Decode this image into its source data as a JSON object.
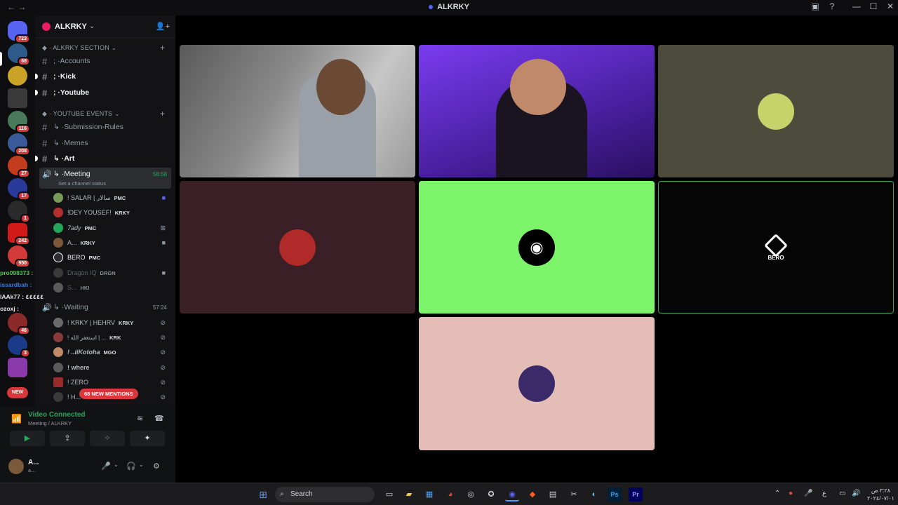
{
  "window": {
    "title": "ALKRKY",
    "nav_back": "←",
    "nav_forward": "→",
    "controls": [
      "▣",
      "?",
      "—",
      "☐",
      "✕"
    ]
  },
  "guilds": [
    {
      "badge": "723",
      "color": "#5865f2"
    },
    {
      "badge": "68",
      "color": "#2d5a8a"
    },
    {
      "badge": "",
      "color": "#c9a227"
    },
    {
      "badge": "",
      "color": "#3a3a3a"
    },
    {
      "badge": "116",
      "color": "#4a7a5a"
    },
    {
      "badge": "208",
      "color": "#3a5a9a"
    },
    {
      "badge": "27",
      "color": "#c43c1e"
    },
    {
      "badge": "17",
      "color": "#2a3a9a"
    },
    {
      "badge": "1",
      "color": "#2a2a2a"
    },
    {
      "badge": "242",
      "color": "#d21a1a"
    },
    {
      "badge": "950",
      "color": "#d23a3a"
    },
    {
      "badge": "46",
      "color": "#8a2a2a"
    },
    {
      "badge": "3",
      "color": "#1a3a8a"
    },
    {
      "badge": "",
      "color": "#8a3aaa"
    },
    {
      "badge": "NEW",
      "color": "#da373c"
    }
  ],
  "server": {
    "name": "ALKRKY",
    "chevron": "⌄",
    "invite_icon": "👤+"
  },
  "categories": [
    {
      "label": "ALKRKY SECTION",
      "plus": "+"
    },
    {
      "label": "YOUTUBE EVENTS",
      "plus": "+"
    }
  ],
  "channels": {
    "accounts": "Accounts",
    "kick": "Kick",
    "youtube": "Youtube",
    "submission_rules": "Submission-Rules",
    "memes": "Memes",
    "art": "Art",
    "meeting": "Meeting",
    "meeting_time": "58:58",
    "meeting_status": "Set a channel status",
    "waiting": "Waiting",
    "waiting_time": "57:24"
  },
  "meeting_users": [
    {
      "name": "! SALAR | سالار",
      "tag": "PMC",
      "color": "#7a9a5a"
    },
    {
      "name": "!DEY YOUSEF!",
      "tag": "KRKY",
      "color": "#b03030"
    },
    {
      "name": "7ady",
      "tag": "PMC",
      "color": "#23a55a"
    },
    {
      "name": "A...",
      "tag": "KRKY",
      "color": "#7a5a3a"
    },
    {
      "name": "BERO",
      "tag": "PMC",
      "color": "#2b2d31"
    },
    {
      "name": "Dragon IQ",
      "tag": "DRGN",
      "color": "#3a3a3a"
    },
    {
      "name": "S...",
      "tag": "HKI",
      "color": "#5a5a5a"
    }
  ],
  "waiting_users": [
    {
      "name": "! KRKY | HEHRV",
      "tag": "KRKY",
      "color": "#6a6a6a"
    },
    {
      "name": "! استغفر الله | ...",
      "tag": "KRK",
      "color": "#8a3a3a"
    },
    {
      "name": "! ..iiKotoha",
      "tag": "MGO",
      "color": "#c08a6a"
    },
    {
      "name": "! where",
      "tag": "",
      "color": "#5a5a5a"
    },
    {
      "name": "! ZERO",
      "tag": "",
      "color": "#9a2a2a"
    },
    {
      "name": "! H...",
      "tag": "",
      "color": "#3a3a3a"
    }
  ],
  "mentions_pill": "68 NEW MENTIONS",
  "overlay_chat": [
    {
      "text": "pro098373 :",
      "color": "#4ec94e"
    },
    {
      "text": "issardbah :",
      "color": "#3a7adc"
    },
    {
      "text": "lAAk77 : ٤٤٤٤٤",
      "color": "#e6e6e6"
    },
    {
      "text": "ozoxj :",
      "color": "#e6e6e6"
    }
  ],
  "voice_panel": {
    "status": "Video Connected",
    "location": "Meeting / ALKRKY",
    "buttons": [
      "▶",
      "⇪",
      "⁘",
      "✦"
    ]
  },
  "user_panel": {
    "name": "A...",
    "sub": "a..."
  },
  "tiles": [
    {
      "label": "",
      "bg": "#6e6e6e"
    },
    {
      "label": "",
      "bg": "#6a2bc4"
    },
    {
      "label": "",
      "bg": "#4d4c3c"
    },
    {
      "label": "",
      "bg": "#3a1f26"
    },
    {
      "label": "",
      "bg": "#7cf46a"
    },
    {
      "label": "BERO",
      "bg": "#050505"
    },
    {
      "label": "",
      "bg": "#e4bdb6"
    }
  ],
  "taskbar": {
    "search_placeholder": "Search",
    "clock_time": "٣:٢٨ ص",
    "clock_date": "٢٠٢٤/٠٧/٠١",
    "lang": "ع"
  }
}
